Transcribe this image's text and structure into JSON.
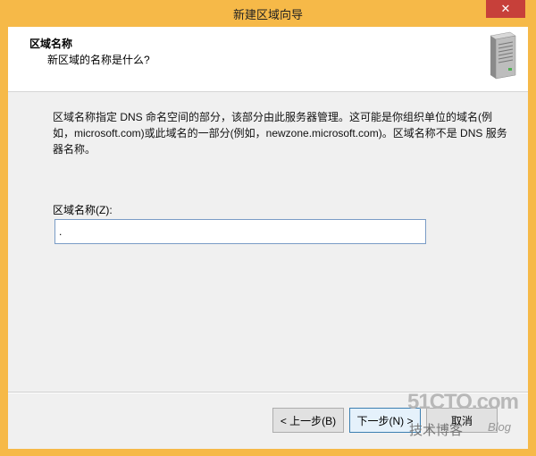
{
  "window": {
    "title": "新建区域向导",
    "close_glyph": "✕"
  },
  "header": {
    "heading": "区域名称",
    "subheading": "新区域的名称是什么?",
    "icon": "server-icon"
  },
  "main": {
    "description": "区域名称指定 DNS 命名空间的部分，该部分由此服务器管理。这可能是你组织单位的域名(例如，microsoft.com)或此域名的一部分(例如，newzone.microsoft.com)。区域名称不是 DNS 服务器名称。",
    "zone_label": "区域名称(Z):",
    "zone_value": "."
  },
  "footer": {
    "back_label": "< 上一步(B)",
    "next_label": "下一步(N) >",
    "cancel_label": "取消"
  },
  "watermark": {
    "logo": "51CTO.com",
    "sub": "技术博客",
    "blog": "Blog"
  },
  "colors": {
    "title_bar": "#f6b948",
    "close_button": "#c7403a",
    "input_border": "#7a9cc6"
  }
}
